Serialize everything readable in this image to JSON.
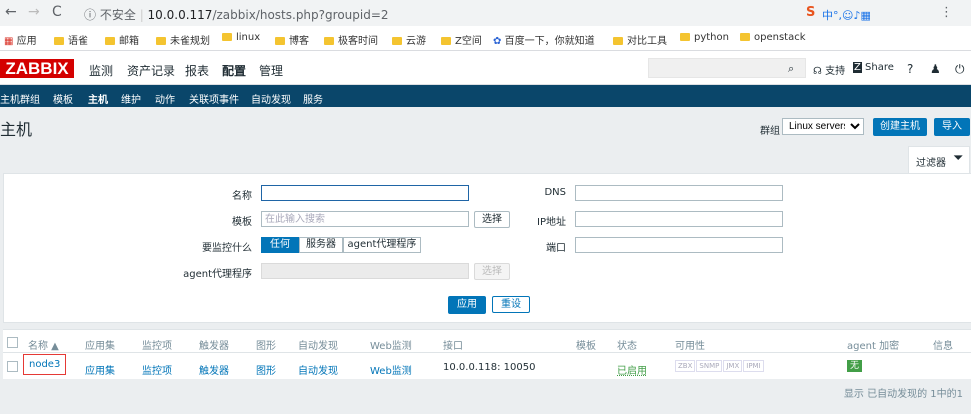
{
  "browser": {
    "url_insecure": "不安全",
    "url_host": "10.0.0.117",
    "url_path": "/zabbix/hosts.php?groupid=2",
    "bookmarks": [
      "应用",
      "语雀",
      "邮箱",
      "未雀规划",
      "linux",
      "博客",
      "极客时间",
      "云游",
      "Z空间",
      "百度一下，你就知道",
      "对比工具",
      "python",
      "openstack"
    ]
  },
  "top": {
    "logo": "ZABBIX",
    "menu": [
      "监测",
      "资产记录",
      "报表",
      "配置",
      "管理"
    ],
    "support": "支持",
    "share": "Share",
    "help": "?"
  },
  "submenu": [
    "主机群组",
    "模板",
    "主机",
    "维护",
    "动作",
    "关联项事件",
    "自动发现",
    "服务"
  ],
  "header": {
    "title": "主机",
    "group_label": "群组",
    "group_value": "Linux servers",
    "create_button": "创建主机",
    "import_button": "导入"
  },
  "filter": {
    "tab_label": "过滤器",
    "name_label": "名称",
    "template_label": "模板",
    "template_placeholder": "在此输入搜索",
    "select_label": "选择",
    "monitored_by_label": "要监控什么",
    "monitored_options": [
      "任何",
      "服务器",
      "agent代理程序"
    ],
    "proxy_label": "agent代理程序",
    "proxy_select": "选择",
    "dns_label": "DNS",
    "ip_label": "IP地址",
    "port_label": "端口",
    "apply_button": "应用",
    "reset_button": "重设"
  },
  "table": {
    "headers": [
      "名称 ▲",
      "应用集",
      "监控项",
      "触发器",
      "图形",
      "自动发现",
      "Web监测",
      "接口",
      "模板",
      "状态",
      "可用性",
      "agent 加密",
      "信息"
    ],
    "rows": [
      {
        "name": "node3",
        "applications": "应用集",
        "items": "监控项",
        "triggers": "触发器",
        "graphs": "图形",
        "discovery": "自动发现",
        "web": "Web监测",
        "interface": "10.0.0.118: 10050",
        "status": "已启用",
        "availability": [
          "ZBX",
          "SNMP",
          "JMX",
          "IPMI"
        ],
        "encryption": "无"
      }
    ],
    "footer_text": "显示 已自动发现的 1中的1"
  },
  "colors": {
    "brand": "#d40000",
    "submenu_bg": "#0a466a",
    "accent": "#0275b8",
    "enabled": "#429e47"
  }
}
